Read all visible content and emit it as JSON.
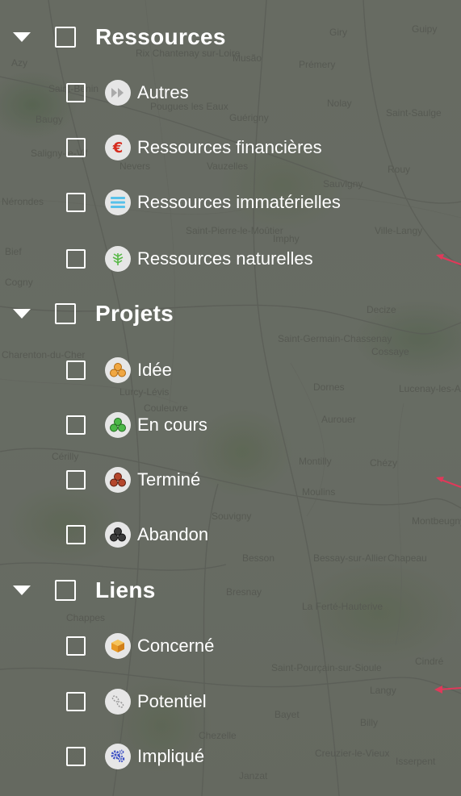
{
  "layer_tree": {
    "groups": [
      {
        "label": "Ressources",
        "items": [
          {
            "label": "Autres",
            "icon": "fast-forward-icon"
          },
          {
            "label": "Ressources financières",
            "icon": "euro-icon"
          },
          {
            "label": "Ressources immatérielles",
            "icon": "list-icon"
          },
          {
            "label": "Ressources naturelles",
            "icon": "leaf-icon"
          }
        ]
      },
      {
        "label": "Projets",
        "items": [
          {
            "label": "Idée",
            "icon": "cluster-orange-icon"
          },
          {
            "label": "En cours",
            "icon": "cluster-green-icon"
          },
          {
            "label": "Terminé",
            "icon": "cluster-brown-icon"
          },
          {
            "label": "Abandon",
            "icon": "cluster-black-icon"
          }
        ]
      },
      {
        "label": "Liens",
        "items": [
          {
            "label": "Concerné",
            "icon": "cube-icon"
          },
          {
            "label": "Potentiel",
            "icon": "link-icon"
          },
          {
            "label": "Impliqué",
            "icon": "gears-icon"
          }
        ]
      }
    ]
  },
  "map_labels": [
    "Azy",
    "Rix Chantenay sur-Loire",
    "Musão",
    "Prémery",
    "Giry",
    "Guipy",
    "Saint-Benin",
    "Baugy",
    "Pougues les Eaux",
    "Guérigny",
    "Nolay",
    "Saint-Saulge",
    "Saligny-le-Vif",
    "Nevers",
    "Vauzelles",
    "Rouy",
    "Sauvigny",
    "Nérondes",
    "Saint-Pierre-le-Moûtier",
    "Imphy",
    "Ville-Langy",
    "Bief",
    "Decize",
    "Cogny",
    "Charenton-du-Cher",
    "Saint-Germain-Chassenay",
    "Cossaye",
    "Lurcy-Lévis",
    "Dornes",
    "Lucenay-les-Aix",
    "Couleuvre",
    "Aurouer",
    "Cérilly",
    "Moulins",
    "Montilly",
    "Chézy",
    "Montbeugny",
    "Souvigny",
    "Besson",
    "Bessay-sur-Allier",
    "Chapeau",
    "Bresnay",
    "Chappes",
    "La Ferté-Hauterive",
    "Cindré",
    "Saint-Pourçain-sur-Sioule",
    "Langy",
    "Bayet",
    "Billy",
    "Chezelle",
    "Creuzier-le-Vieux",
    "Isserpent",
    "Janzat"
  ],
  "colors": {
    "text": "#ffffff",
    "annotation_arrow": "#e0395a",
    "euro": "#d62d20",
    "list": "#58c1ea",
    "leaf": "#58b847"
  }
}
